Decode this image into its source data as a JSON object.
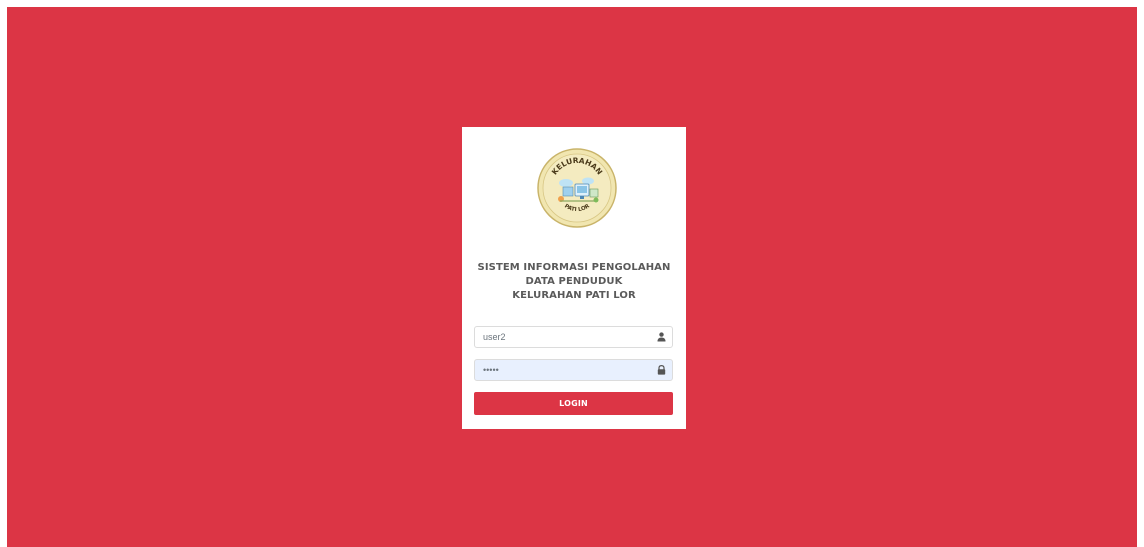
{
  "app": {
    "background_color": "#dc3545"
  },
  "logo": {
    "icon": "kelurahan-seal-logo",
    "top_text": "KELURAHAN",
    "bottom_text": "PATI LOR"
  },
  "title_lines": [
    "SISTEM INFORMASI PENGOLAHAN",
    "DATA PENDUDUK",
    "KELURAHAN PATI LOR"
  ],
  "form": {
    "username": {
      "value": "user2",
      "icon": "user-icon"
    },
    "password": {
      "value": "•••••",
      "icon": "lock-icon"
    },
    "login_label": "LOGIN"
  }
}
